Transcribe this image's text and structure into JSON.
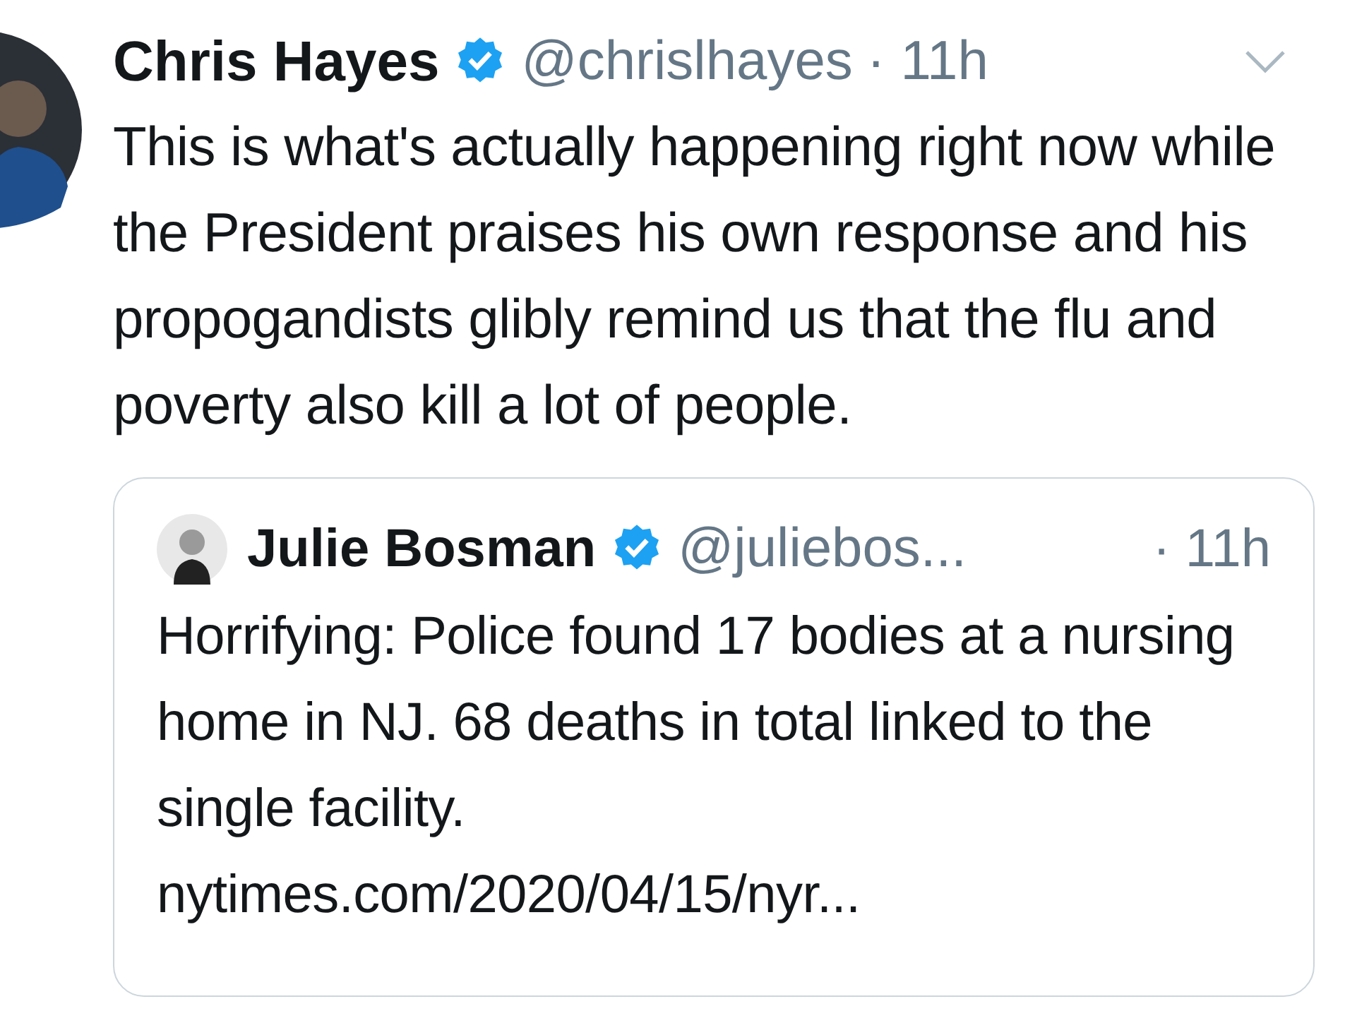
{
  "tweet": {
    "name": "Chris Hayes",
    "verified": true,
    "handle": "@chrislhayes",
    "time": "· 11h",
    "text": "This is what's actually happening right now while the President praises his own response and his propogandists glibly remind us that the flu and poverty also kill a lot of people.",
    "quoted": {
      "name": "Julie Bosman",
      "verified": true,
      "handle": "@juliebos...",
      "time": "· 11h",
      "text": "Horrifying: Police found 17 bodies at a nursing home in NJ. 68 deaths in total linked to the single facility.",
      "link": "nytimes.com/2020/04/15/nyr..."
    }
  }
}
